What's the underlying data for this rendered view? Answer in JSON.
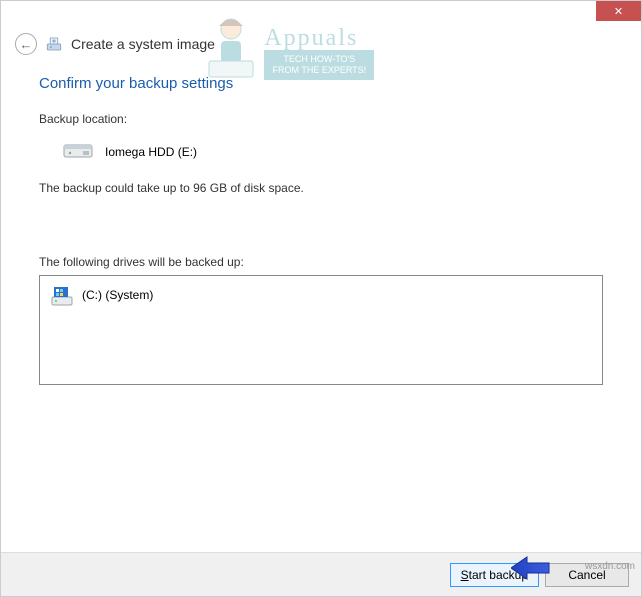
{
  "titlebar": {
    "close": "✕"
  },
  "header": {
    "back": "←",
    "title": "Create a system image"
  },
  "main": {
    "confirm_heading": "Confirm your backup settings",
    "location_label": "Backup location:",
    "location_value": "Iomega HDD (E:)",
    "space_text": "The backup could take up to 96 GB of disk space.",
    "drives_label": "The following drives will be backed up:",
    "drives": [
      {
        "label": "(C:) (System)"
      }
    ]
  },
  "buttons": {
    "start": "Start backup",
    "cancel": "Cancel"
  },
  "watermark": {
    "brand": "Appuals",
    "sub": "TECH HOW-TO'S FROM THE EXPERTS!",
    "site": "wsxdn.com"
  }
}
